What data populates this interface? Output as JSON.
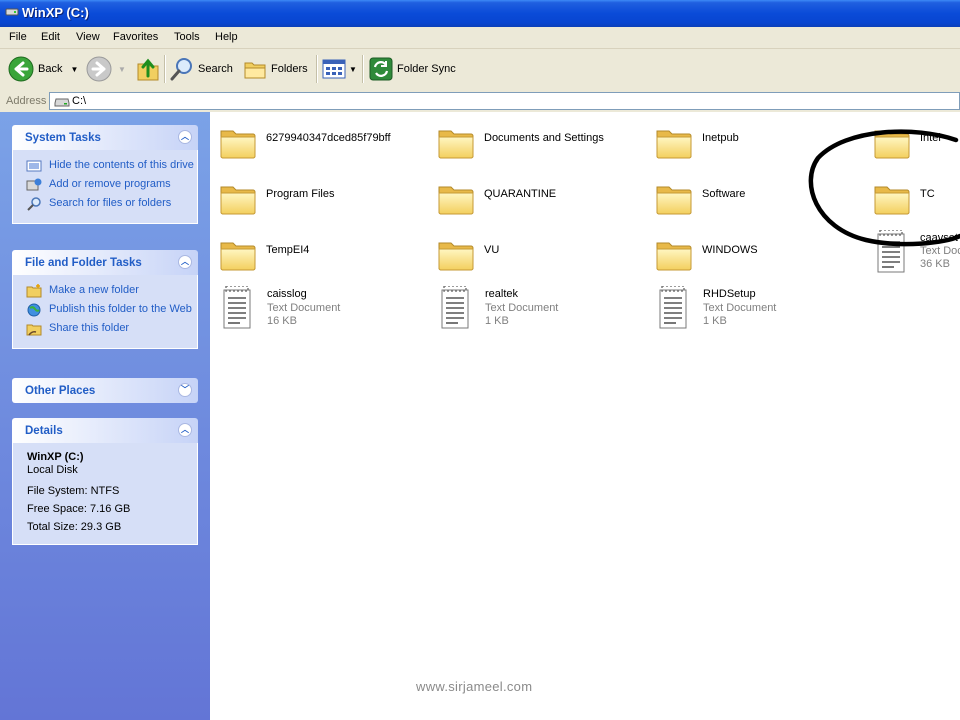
{
  "window": {
    "title": "WinXP (C:)"
  },
  "menu": [
    "File",
    "Edit",
    "View",
    "Favorites",
    "Tools",
    "Help"
  ],
  "toolbar": {
    "back_label": "Back",
    "search_label": "Search",
    "folders_label": "Folders",
    "foldersync_label": "Folder Sync"
  },
  "address": {
    "label": "Address",
    "value": "C:\\"
  },
  "sidebar": {
    "system_tasks": {
      "title": "System Tasks",
      "items": [
        {
          "label": "Hide the contents of this drive",
          "icon": "hide-icon"
        },
        {
          "label": "Add or remove programs",
          "icon": "add-remove-icon"
        },
        {
          "label": "Search for files or folders",
          "icon": "search-icon"
        }
      ]
    },
    "file_tasks": {
      "title": "File and Folder Tasks",
      "items": [
        {
          "label": "Make a new folder",
          "icon": "new-folder-icon"
        },
        {
          "label": "Publish this folder to the Web",
          "icon": "globe-icon"
        },
        {
          "label": "Share this folder",
          "icon": "share-icon"
        }
      ]
    },
    "other_places": {
      "title": "Other Places"
    },
    "details": {
      "title": "Details",
      "name": "WinXP (C:)",
      "type": "Local Disk",
      "filesystem": "File System: NTFS",
      "free": "Free Space: 7.16 GB",
      "total": "Total Size: 29.3 GB"
    }
  },
  "files": [
    {
      "name": "6279940347dced85f79bff",
      "kind": "folder"
    },
    {
      "name": "Documents and Settings",
      "kind": "folder"
    },
    {
      "name": "Inetpub",
      "kind": "folder"
    },
    {
      "name": "Intel",
      "kind": "folder"
    },
    {
      "name": "Program Files",
      "kind": "folder"
    },
    {
      "name": "QUARANTINE",
      "kind": "folder"
    },
    {
      "name": "Software",
      "kind": "folder"
    },
    {
      "name": "TC",
      "kind": "folder"
    },
    {
      "name": "TempEI4",
      "kind": "folder"
    },
    {
      "name": "VU",
      "kind": "folder"
    },
    {
      "name": "WINDOWS",
      "kind": "folder"
    },
    {
      "name": "caavset",
      "kind": "document",
      "type": "Text Document",
      "size": "36 KB"
    },
    {
      "name": "caisslog",
      "kind": "document",
      "type": "Text Document",
      "size": "16 KB"
    },
    {
      "name": "realtek",
      "kind": "document",
      "type": "Text Document",
      "size": "1 KB"
    },
    {
      "name": "RHDSetup",
      "kind": "document",
      "type": "Text Document",
      "size": "1 KB"
    }
  ],
  "watermark": "www.sirjameel.com"
}
